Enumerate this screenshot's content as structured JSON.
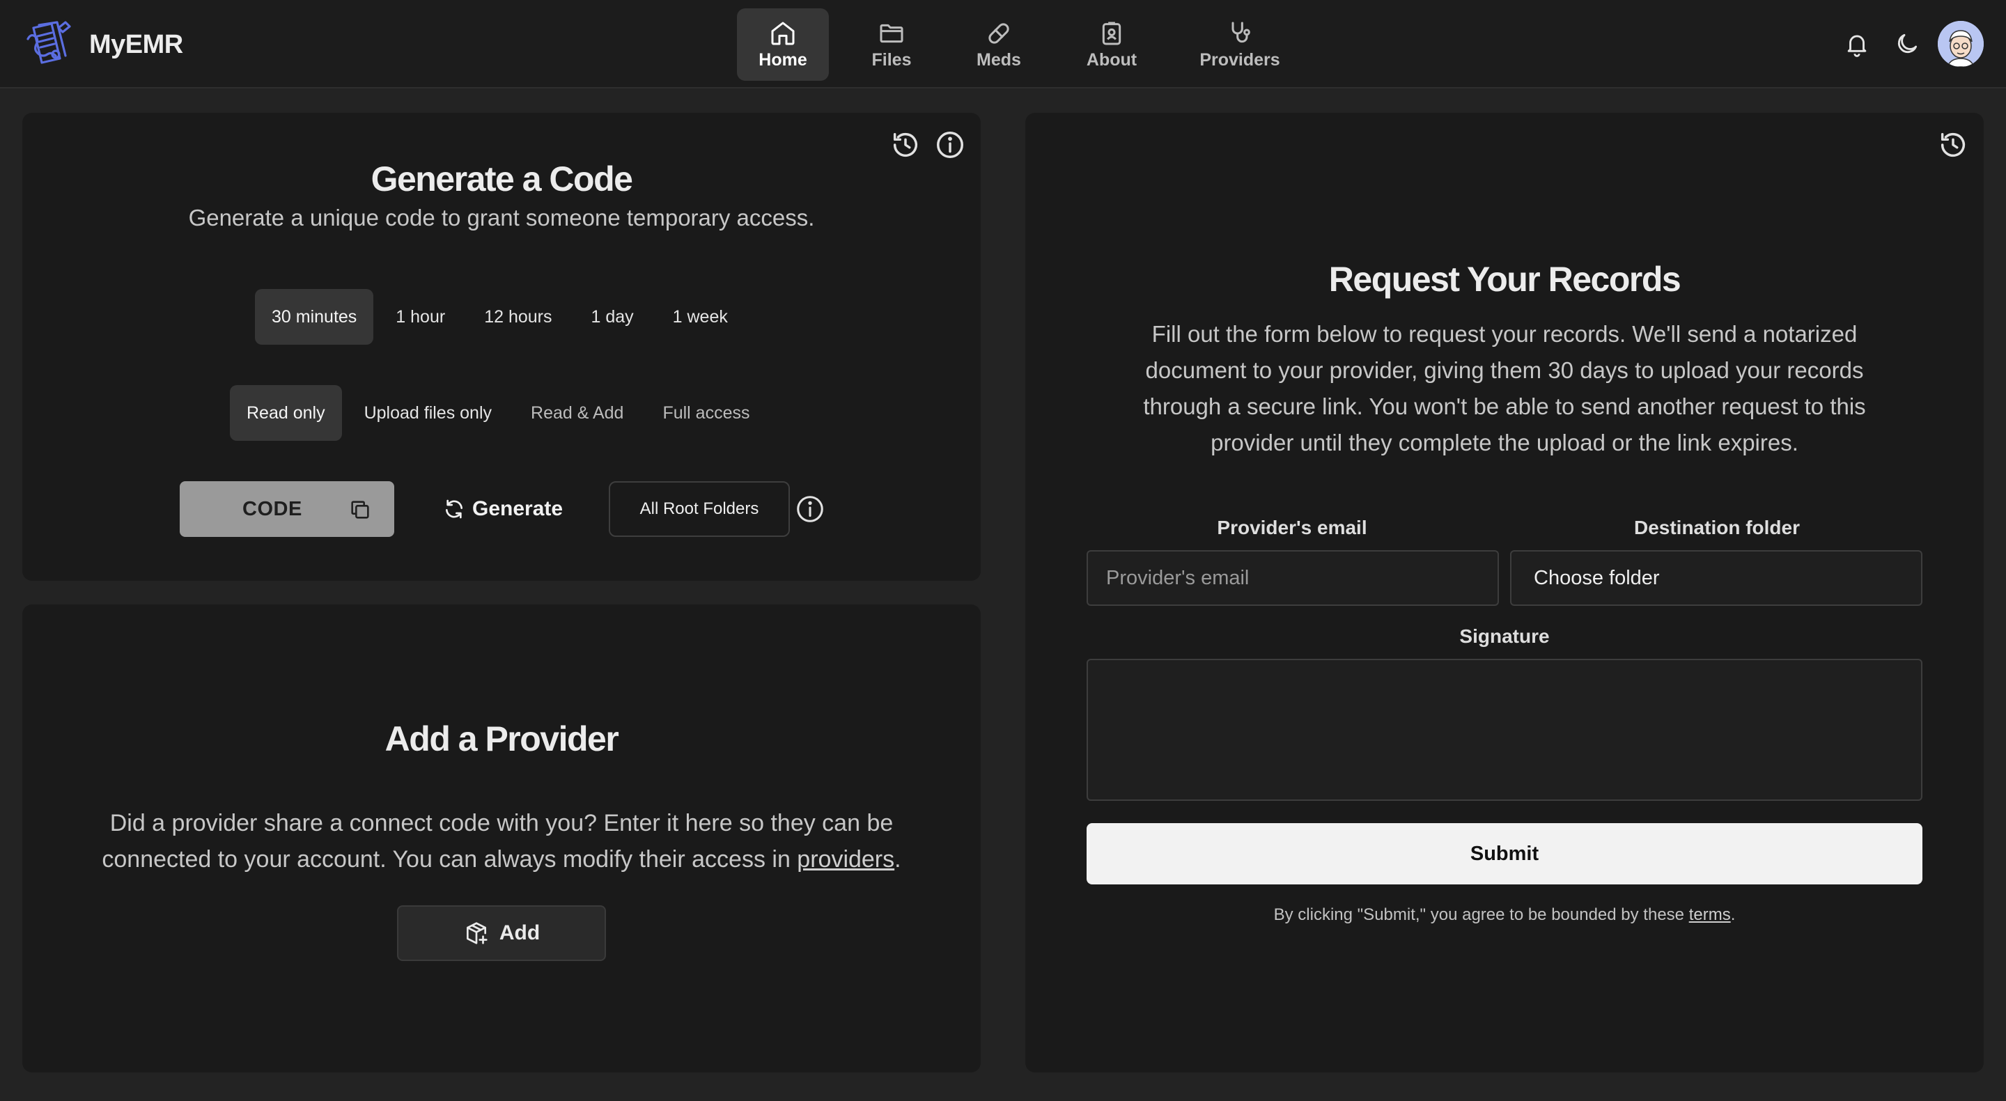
{
  "app": {
    "name": "MyEMR"
  },
  "nav": {
    "items": [
      {
        "label": "Home",
        "icon": "home-icon",
        "active": true
      },
      {
        "label": "Files",
        "icon": "folder-icon",
        "active": false
      },
      {
        "label": "Meds",
        "icon": "pill-icon",
        "active": false
      },
      {
        "label": "About",
        "icon": "id-badge-icon",
        "active": false
      },
      {
        "label": "Providers",
        "icon": "stethoscope-icon",
        "active": false
      }
    ],
    "right_icons": [
      "bell-icon",
      "moon-icon",
      "avatar"
    ]
  },
  "generate_code": {
    "title": "Generate a Code",
    "subtitle": "Generate a unique code to grant someone temporary access.",
    "durations": [
      {
        "label": "30 minutes",
        "selected": true
      },
      {
        "label": "1 hour",
        "selected": false
      },
      {
        "label": "12 hours",
        "selected": false
      },
      {
        "label": "1 day",
        "selected": false
      },
      {
        "label": "1 week",
        "selected": false
      }
    ],
    "access_levels": [
      {
        "label": "Read only",
        "selected": true
      },
      {
        "label": "Upload files only",
        "selected": false
      },
      {
        "label": "Read & Add",
        "selected": false
      },
      {
        "label": "Full access",
        "selected": false
      }
    ],
    "code_label": "CODE",
    "generate_label": "Generate",
    "folders_label": "All Root Folders"
  },
  "add_provider": {
    "title": "Add a Provider",
    "desc_before": "Did a provider share a connect code with you? Enter it here so they can be connected to your account. You can always modify their access in ",
    "desc_link": "providers",
    "desc_after": ".",
    "button_label": "Add"
  },
  "request_records": {
    "title": "Request Your Records",
    "description": "Fill out the form below to request your records. We'll send a notarized document to your provider, giving them 30 days to upload your records through a secure link. You won't be able to send another request to this provider until they complete the upload or the link expires.",
    "email_label": "Provider's email",
    "email_placeholder": "Provider's email",
    "email_value": "",
    "folder_label": "Destination folder",
    "folder_value": "Choose folder",
    "signature_label": "Signature",
    "submit_label": "Submit",
    "terms_before": "By clicking \"Submit,\" you agree to be bounded by these ",
    "terms_link": "terms",
    "terms_after": "."
  },
  "colors": {
    "background": "#232323",
    "card": "#1a1a1a",
    "topbar": "#1c1c1c",
    "accent_logo": "#5b6ee1",
    "active_chip": "#363636",
    "code_button": "#9a9a9a",
    "submit_button": "#f2f2f2"
  }
}
